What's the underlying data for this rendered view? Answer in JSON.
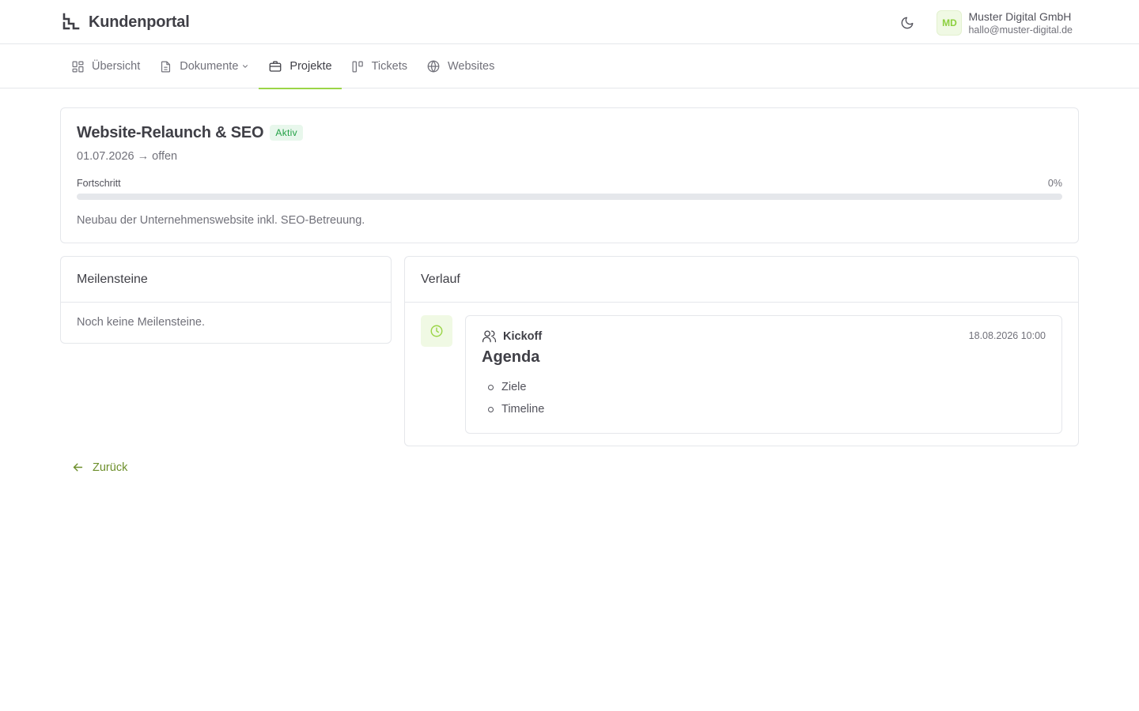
{
  "header": {
    "brand": "Kundenportal",
    "user": {
      "initials": "MD",
      "company": "Muster Digital GmbH",
      "email": "hallo@muster-digital.de"
    }
  },
  "nav": {
    "items": [
      {
        "label": "Übersicht",
        "icon": "dashboard-icon",
        "active": false
      },
      {
        "label": "Dokumente",
        "icon": "document-icon",
        "active": false,
        "has_dropdown": true
      },
      {
        "label": "Projekte",
        "icon": "briefcase-icon",
        "active": true
      },
      {
        "label": "Tickets",
        "icon": "kanban-icon",
        "active": false
      },
      {
        "label": "Websites",
        "icon": "globe-icon",
        "active": false
      }
    ]
  },
  "project": {
    "title": "Website-Relaunch & SEO",
    "status": "Aktiv",
    "dates": "01.07.2026 → offen",
    "progress_label": "Fortschritt",
    "progress_text": "0%",
    "progress_value": 0,
    "description": "Neubau der Unternehmenswebsite inkl. SEO-Betreuung."
  },
  "milestones": {
    "title": "Meilensteine",
    "empty": "Noch keine Meilensteine."
  },
  "history": {
    "title": "Verlauf",
    "events": [
      {
        "type": "Kickoff",
        "timestamp": "18.08.2026 10:00",
        "heading": "Agenda",
        "items": [
          "Ziele",
          "Timeline"
        ]
      }
    ]
  },
  "back_label": "Zurück",
  "colors": {
    "accent": "#9bd548",
    "link": "#6d8f2b",
    "status_active": "#22a145"
  }
}
